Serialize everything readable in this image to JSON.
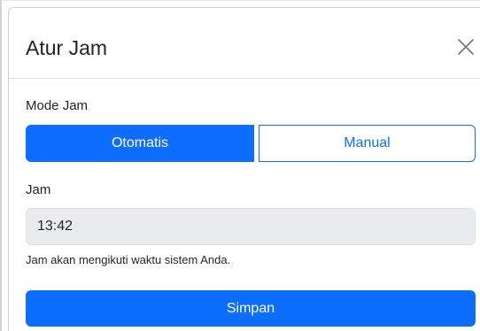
{
  "modal": {
    "title": "Atur Jam",
    "close_icon": "close-icon"
  },
  "mode": {
    "label": "Mode Jam",
    "options": [
      {
        "label": "Otomatis",
        "selected": true
      },
      {
        "label": "Manual",
        "selected": false
      }
    ]
  },
  "time": {
    "label": "Jam",
    "value": "13:42",
    "readonly": true,
    "help": "Jam akan mengikuti waktu sistem Anda."
  },
  "actions": {
    "save_label": "Simpan"
  },
  "colors": {
    "primary": "#0d6efd",
    "input_disabled_bg": "#e9ecef",
    "text": "#212529",
    "divider": "#dee2e6"
  }
}
